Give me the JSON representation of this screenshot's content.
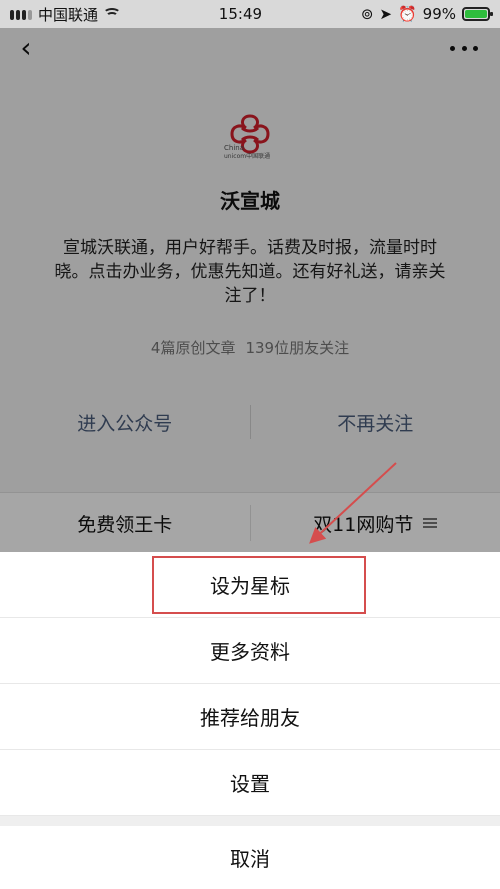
{
  "status_bar": {
    "carrier": "中国联通",
    "time": "15:49",
    "battery": "99%",
    "battery_level": 0.99,
    "icons": [
      "signal-icon",
      "wifi-icon",
      "lock-rotation-icon",
      "location-icon",
      "alarm-icon",
      "battery-icon"
    ]
  },
  "profile": {
    "logo_text_line1": "China",
    "logo_text_line2": "unicom中国联通",
    "name": "沃宣城",
    "description": "宣城沃联通，用户好帮手。话费及时报，流量时时晓。点击办业务，优惠先知道。还有好礼送，请亲关注了！",
    "stats": [
      "4篇原创文章",
      "139位朋友关注"
    ],
    "actions": [
      "进入公众号",
      "不再关注"
    ],
    "menu": [
      "免费领王卡",
      "双11网购节"
    ]
  },
  "action_sheet": {
    "options": [
      "设为星标",
      "更多资料",
      "推荐给朋友",
      "设置"
    ],
    "cancel": "取消",
    "highlight_color": "#d54d4d"
  },
  "colors": {
    "annotation_red": "#d54d4d",
    "action_link": "#4a5d7c"
  }
}
